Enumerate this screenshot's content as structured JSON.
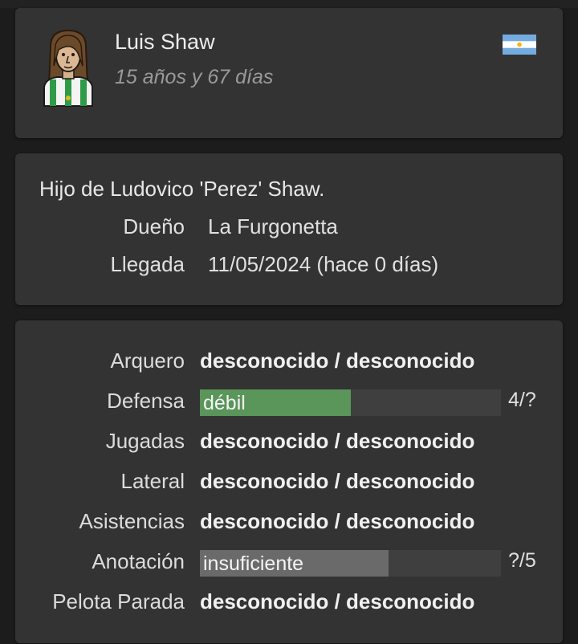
{
  "player": {
    "name": "Luis Shaw",
    "age": "15 años y 67 días",
    "nationality_flag": "argentina-flag-icon"
  },
  "info": {
    "lineage": "Hijo de Ludovico 'Perez' Shaw.",
    "owner_label": "Dueño",
    "owner_value": "La Furgonetta",
    "arrival_label": "Llegada",
    "arrival_value": "11/05/2024 (hace 0 días)"
  },
  "skills": [
    {
      "label": "Arquero",
      "type": "text",
      "value": "desconocido / desconocido"
    },
    {
      "label": "Defensa",
      "type": "bar",
      "bar_text": "débil",
      "fill_fraction": 0.5,
      "bar_color": "#5a955a",
      "score": "4/?"
    },
    {
      "label": "Jugadas",
      "type": "text",
      "value": "desconocido / desconocido"
    },
    {
      "label": "Lateral",
      "type": "text",
      "value": "desconocido / desconocido"
    },
    {
      "label": "Asistencias",
      "type": "text",
      "value": "desconocido / desconocido"
    },
    {
      "label": "Anotación",
      "type": "bar",
      "bar_text": "insuficiente",
      "fill_fraction": 0.626,
      "bar_color": "#6a6a6a",
      "score": "?/5"
    },
    {
      "label": "Pelota Parada",
      "type": "text",
      "value": "desconocido / desconocido"
    }
  ],
  "colors": {
    "background": "#1c1c1c",
    "card": "#333333",
    "bar_track": "#3f3f3f",
    "bar_green": "#5a955a",
    "bar_gray": "#6a6a6a"
  }
}
